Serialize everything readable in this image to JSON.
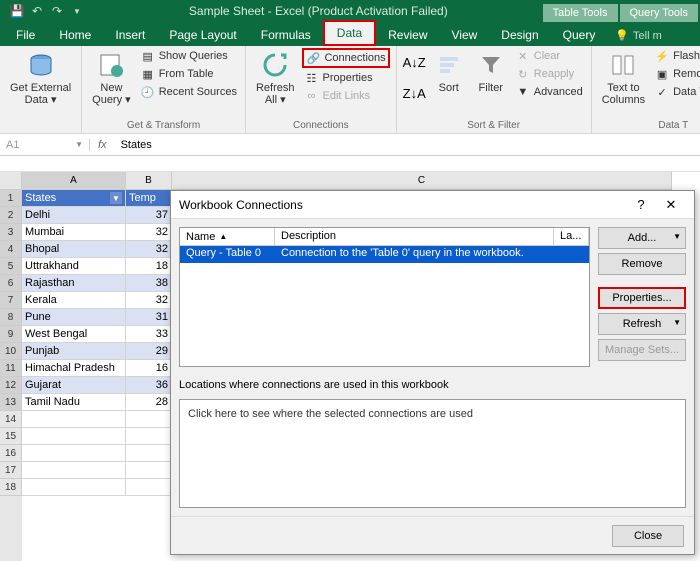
{
  "titlebar": {
    "title": "Sample Sheet - Excel (Product Activation Failed)",
    "context_tabs": [
      "Table Tools",
      "Query Tools"
    ]
  },
  "tabs": {
    "file": "File",
    "home": "Home",
    "insert": "Insert",
    "page_layout": "Page Layout",
    "formulas": "Formulas",
    "data": "Data",
    "review": "Review",
    "view": "View",
    "design": "Design",
    "query": "Query",
    "tell_me": "Tell m"
  },
  "ribbon": {
    "get_external": "Get External\nData ▾",
    "new_query": "New\nQuery ▾",
    "show_queries": "Show Queries",
    "from_table": "From Table",
    "recent_sources": "Recent Sources",
    "group_get_transform": "Get & Transform",
    "refresh_all": "Refresh\nAll ▾",
    "connections": "Connections",
    "properties": "Properties",
    "edit_links": "Edit Links",
    "group_connections": "Connections",
    "sort": "Sort",
    "filter": "Filter",
    "clear": "Clear",
    "reapply": "Reapply",
    "advanced": "Advanced",
    "group_sort_filter": "Sort & Filter",
    "text_to_columns": "Text to\nColumns",
    "flash_fill": "Flash Fill",
    "remove_dup": "Remove Dupl",
    "data_validation": "Data Validation",
    "group_data_tools": "Data T"
  },
  "formula_bar": {
    "namebox": "A1",
    "formula": "States"
  },
  "sheet": {
    "col_headers": [
      "A",
      "B",
      "C"
    ],
    "table_headers": [
      "States",
      "Temp"
    ],
    "rows": [
      {
        "a": "Delhi",
        "b": "37"
      },
      {
        "a": "Mumbai",
        "b": "32"
      },
      {
        "a": "Bhopal",
        "b": "32"
      },
      {
        "a": "Uttrakhand",
        "b": "18"
      },
      {
        "a": "Rajasthan",
        "b": "38"
      },
      {
        "a": "Kerala",
        "b": "32"
      },
      {
        "a": "Pune",
        "b": "31"
      },
      {
        "a": "West Bengal",
        "b": "33"
      },
      {
        "a": "Punjab",
        "b": "29"
      },
      {
        "a": "Himachal Pradesh",
        "b": "16"
      },
      {
        "a": "Gujarat",
        "b": "36"
      },
      {
        "a": "Tamil Nadu",
        "b": "28"
      }
    ]
  },
  "dialog": {
    "title": "Workbook Connections",
    "col_name": "Name",
    "col_desc": "Description",
    "col_last": "La...",
    "row_name": "Query - Table 0",
    "row_desc": "Connection to the 'Table 0' query in the workbook.",
    "btn_add": "Add...",
    "btn_remove": "Remove",
    "btn_properties": "Properties...",
    "btn_refresh": "Refresh",
    "btn_manage": "Manage Sets...",
    "locations_label": "Locations where connections are used in this workbook",
    "locations_hint": "Click here to see where the selected connections are used",
    "btn_close": "Close"
  }
}
